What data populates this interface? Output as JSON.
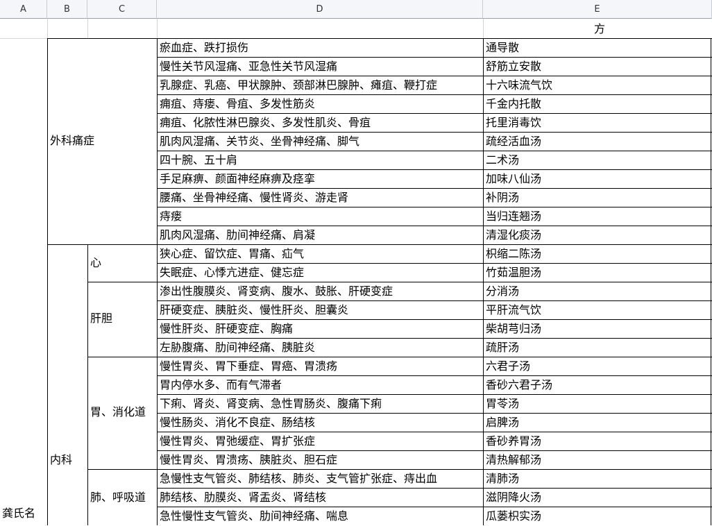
{
  "columns": [
    "A",
    "B",
    "C",
    "D",
    "E"
  ],
  "header_row": {
    "e_text": "方"
  },
  "col_a_label": "龚氏名",
  "groups": {
    "surgery": "外科痛症",
    "internal": "内科",
    "heart": "心",
    "liver": "肝胆",
    "stomach": "胃、消化道",
    "lung": "肺、呼吸道"
  },
  "rows": [
    {
      "disease": "瘀血症、跌打损伤",
      "formula": "通导散"
    },
    {
      "disease": "慢性关节风湿痛、亚急性关节风湿痛",
      "formula": "舒筋立安散"
    },
    {
      "disease": "乳腺症、乳癌、甲状腺肿、颈部淋巴腺肿、瘫疽、鞭打症",
      "formula": "十六味流气饮"
    },
    {
      "disease": "痈疽、痔瘘、骨疽、多发性筋炎",
      "formula": "千金内托散"
    },
    {
      "disease": "痈疽、化脓性淋巴腺炎、多发性肌炎、骨疽",
      "formula": "托里消毒饮"
    },
    {
      "disease": "肌肉风湿痛、关节炎、坐骨神经痛、脚气",
      "formula": "疏经活血汤"
    },
    {
      "disease": "四十腕、五十肩",
      "formula": "二术汤"
    },
    {
      "disease": "手足麻痹、颜面神经麻痹及痉挛",
      "formula": "加味八仙汤"
    },
    {
      "disease": "腰痛、坐骨神经痛、慢性肾炎、游走肾",
      "formula": "补阴汤"
    },
    {
      "disease": "痔瘘",
      "formula": "当归连翘汤"
    },
    {
      "disease": "肌肉风湿痛、肋间神经痛、肩凝",
      "formula": "清湿化痰汤"
    },
    {
      "disease": "狭心症、留饮症、胃痛、疝气",
      "formula": "枳缩二陈汤"
    },
    {
      "disease": "失眠症、心悸亢进症、健忘症",
      "formula": "竹茹温胆汤"
    },
    {
      "disease": "渗出性腹膜炎、肾变病、腹水、鼓胀、肝硬变症",
      "formula": "分消汤"
    },
    {
      "disease": "肝硬变症、胰脏炎、慢性肝炎、胆囊炎",
      "formula": "平肝流气饮"
    },
    {
      "disease": "慢性肝炎、肝硬变症、胸痛",
      "formula": "柴胡芎归汤"
    },
    {
      "disease": "左胁腹痛、肋间神经痛、胰脏炎",
      "formula": "疏肝汤"
    },
    {
      "disease": "慢性胃炎、胃下垂症、胃癌、胃溃疡",
      "formula": "六君子汤"
    },
    {
      "disease": "胃内停水多、而有气滞者",
      "formula": "香砂六君子汤"
    },
    {
      "disease": "下痢、肾炎、肾变病、急性胃肠炎、腹痛下痢",
      "formula": "胃苓汤"
    },
    {
      "disease": "慢性肠炎、消化不良症、肠结核",
      "formula": "启脾汤"
    },
    {
      "disease": "慢性胃炎、胃弛缓症、胃扩张症",
      "formula": "香砂养胃汤"
    },
    {
      "disease": "慢性胃炎、胃溃疡、胰脏炎、胆石症",
      "formula": "清热解郁汤"
    },
    {
      "disease": "急慢性支气管炎、肺结核、肺炎、支气管扩张症、痔出血",
      "formula": "清肺汤"
    },
    {
      "disease": "肺结核、肋膜炎、肾盂炎、肾结核",
      "formula": "滋阴降火汤"
    },
    {
      "disease": "急性慢性支气管炎、肋间神经痛、喘息",
      "formula": "瓜蒌枳实汤"
    }
  ]
}
